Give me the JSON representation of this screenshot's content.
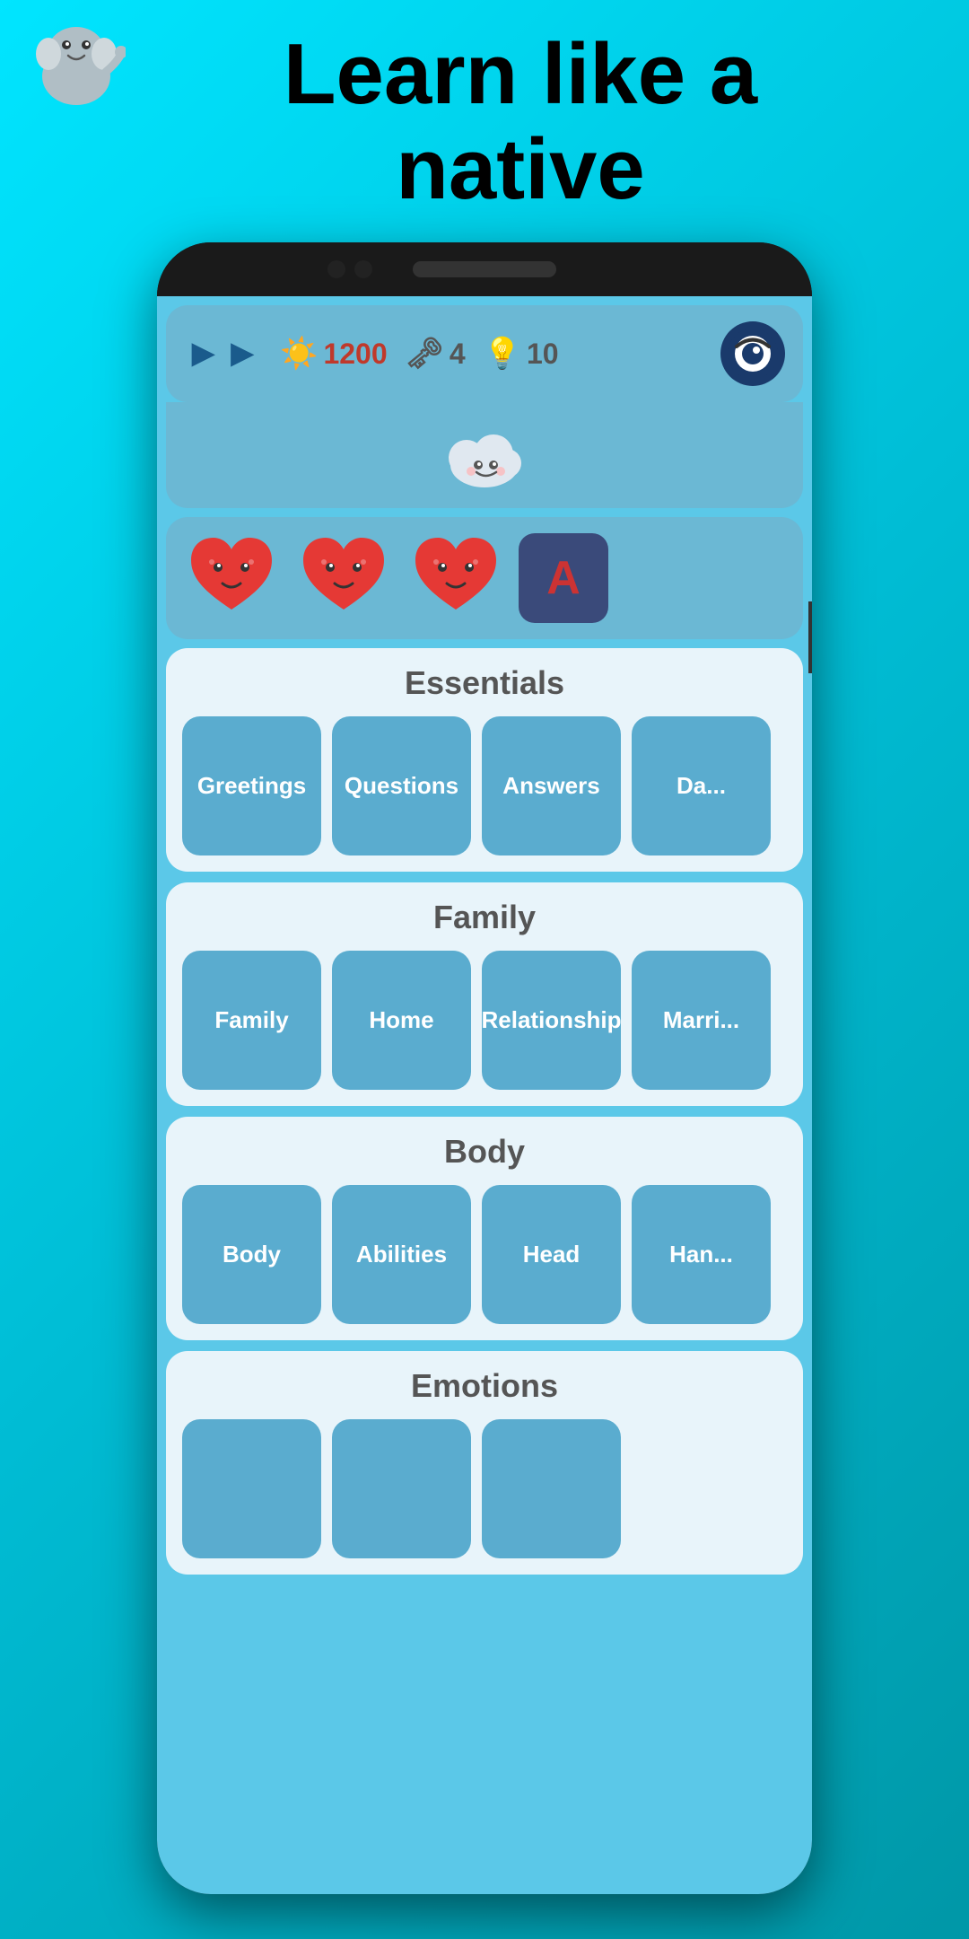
{
  "header": {
    "title_line1": "Learn like a",
    "title_line2": "native"
  },
  "stats": {
    "xp": "1200",
    "keys": "4",
    "bulbs": "10",
    "xp_icon": "☀",
    "key_icon": "🔑",
    "bulb_icon": "💡"
  },
  "hearts": {
    "count": 3,
    "letter": "A"
  },
  "sections": [
    {
      "title": "Essentials",
      "items": [
        {
          "label": "Greetings"
        },
        {
          "label": "Questions"
        },
        {
          "label": "Answers"
        },
        {
          "label": "Da..."
        }
      ]
    },
    {
      "title": "Family",
      "items": [
        {
          "label": "Family"
        },
        {
          "label": "Home"
        },
        {
          "label": "Relationship"
        },
        {
          "label": "Marri..."
        }
      ]
    },
    {
      "title": "Body",
      "items": [
        {
          "label": "Body"
        },
        {
          "label": "Abilities"
        },
        {
          "label": "Head"
        },
        {
          "label": "Han..."
        }
      ]
    },
    {
      "title": "Emotions",
      "items": [
        {
          "label": ""
        },
        {
          "label": ""
        },
        {
          "label": ""
        }
      ]
    }
  ]
}
